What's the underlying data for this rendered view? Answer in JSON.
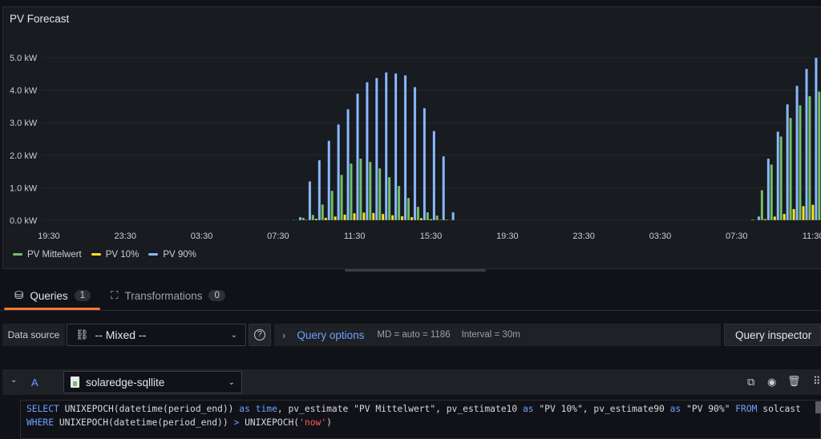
{
  "panel": {
    "title": "PV Forecast"
  },
  "chart_data": {
    "type": "bar",
    "title": "PV Forecast",
    "unit": "kW",
    "ylim": [
      0,
      5.0
    ],
    "yticks": [
      "0.0 kW",
      "1.0 kW",
      "2.0 kW",
      "3.0 kW",
      "4.0 kW",
      "5.0 kW"
    ],
    "xticks": [
      "19:30",
      "23:30",
      "03:30",
      "07:30",
      "11:30",
      "15:30",
      "19:30",
      "23:30",
      "03:30",
      "07:30",
      "11:30"
    ],
    "x_hours_since_19_00": [
      13,
      13.5,
      14,
      14.5,
      15,
      15.5,
      16,
      16.5,
      17,
      17.5,
      18,
      18.5,
      19,
      19.5,
      20,
      20.5,
      21,
      37,
      37.5,
      38,
      38.5,
      39,
      39.5,
      40,
      40.5
    ],
    "series": [
      {
        "name": "PV Mittelwert",
        "color": "#73bf69",
        "values": [
          0.02,
          0.08,
          0.17,
          0.49,
          0.91,
          1.4,
          1.75,
          1.9,
          1.8,
          1.6,
          1.33,
          1.06,
          0.69,
          0.42,
          0.25,
          0.15,
          0.03,
          0.03,
          0.93,
          1.72,
          2.58,
          3.15,
          3.54,
          3.82,
          3.96
        ]
      },
      {
        "name": "PV 10%",
        "color": "#fade2a",
        "values": [
          0,
          0.02,
          0.05,
          0.08,
          0.12,
          0.18,
          0.22,
          0.24,
          0.23,
          0.2,
          0.16,
          0.13,
          0.1,
          0.07,
          0.04,
          0.02,
          0,
          0,
          0.04,
          0.12,
          0.2,
          0.35,
          0.44,
          0.48,
          0.53
        ]
      },
      {
        "name": "PV 90%",
        "color": "#8ab8ff",
        "values": [
          0.1,
          1.2,
          1.85,
          2.45,
          2.95,
          3.42,
          3.9,
          4.25,
          4.38,
          4.55,
          4.52,
          4.46,
          4.1,
          3.45,
          2.75,
          1.97,
          0.25,
          0.12,
          1.9,
          2.73,
          3.57,
          4.14,
          4.66,
          5.0,
          5.2
        ]
      }
    ],
    "legend": "bottom-left"
  },
  "tabs": [
    {
      "label": "Queries",
      "count": "1"
    },
    {
      "label": "Transformations",
      "count": "0"
    }
  ],
  "toolbar": {
    "datasource_label": "Data source",
    "datasource_value": "-- Mixed --",
    "query_options": "Query options",
    "md": "MD = auto = 1186",
    "interval": "Interval = 30m",
    "inspector": "Query inspector"
  },
  "query": {
    "ref": "A",
    "datasource": "solaredge-sqllite",
    "line1": [
      [
        "kw",
        "SELECT"
      ],
      [
        "t",
        " UNIXEPOCH(datetime(period_end)) "
      ],
      [
        "kw",
        "as"
      ],
      [
        "t",
        " "
      ],
      [
        "kw",
        "time"
      ],
      [
        "t",
        ", pv_estimate \"PV Mittelwert\", pv_estimate10 "
      ],
      [
        "kw",
        "as"
      ],
      [
        "t",
        " \"PV 10%\", pv_estimate90 "
      ],
      [
        "kw",
        "as"
      ],
      [
        "t",
        " \"PV 90%\" "
      ],
      [
        "kw",
        "FROM"
      ],
      [
        "t",
        " solcast"
      ]
    ],
    "line2": [
      [
        "kw",
        "WHERE"
      ],
      [
        "t",
        " UNIXEPOCH(datetime(period_end)) "
      ],
      [
        "kw",
        ">"
      ],
      [
        "t",
        " UNIXEPOCH("
      ],
      [
        "str",
        "'now'"
      ],
      [
        "t",
        ")"
      ]
    ]
  }
}
